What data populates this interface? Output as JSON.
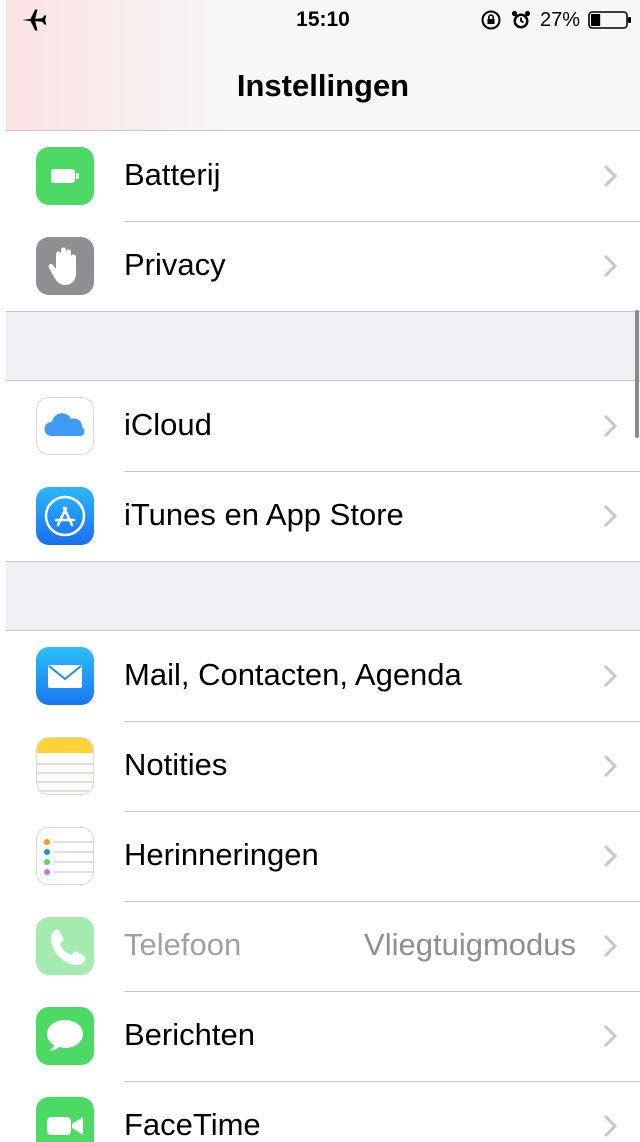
{
  "status_bar": {
    "time": "15:10",
    "battery_percent_label": "27%",
    "battery_level": 0.27,
    "icons": [
      "airplane-icon",
      "rotation-lock-icon",
      "alarm-icon",
      "battery-icon"
    ]
  },
  "nav": {
    "title": "Instellingen"
  },
  "groups": [
    {
      "rows": [
        {
          "label": "Batterij",
          "icon": "battery-app-icon",
          "color": "#4cd964"
        },
        {
          "label": "Privacy",
          "icon": "privacy-hand-icon",
          "color": "#8e8e93"
        }
      ]
    },
    {
      "rows": [
        {
          "label": "iCloud",
          "icon": "icloud-icon",
          "color": "#ffffff"
        },
        {
          "label": "iTunes en App Store",
          "icon": "app-store-icon",
          "color": "#1a8cf5"
        }
      ]
    },
    {
      "rows": [
        {
          "label": "Mail, Contacten, Agenda",
          "icon": "mail-icon",
          "color": "#1a8cf5"
        },
        {
          "label": "Notities",
          "icon": "notes-icon",
          "color": "#ffd60a"
        },
        {
          "label": "Herinneringen",
          "icon": "reminders-icon",
          "color": "#ffffff"
        },
        {
          "label": "Telefoon",
          "value": "Vliegtuigmodus",
          "icon": "phone-icon",
          "color": "#4cd964",
          "disabled": true
        },
        {
          "label": "Berichten",
          "icon": "messages-icon",
          "color": "#4cd964"
        },
        {
          "label": "FaceTime",
          "icon": "facetime-icon",
          "color": "#4cd964"
        }
      ]
    }
  ]
}
